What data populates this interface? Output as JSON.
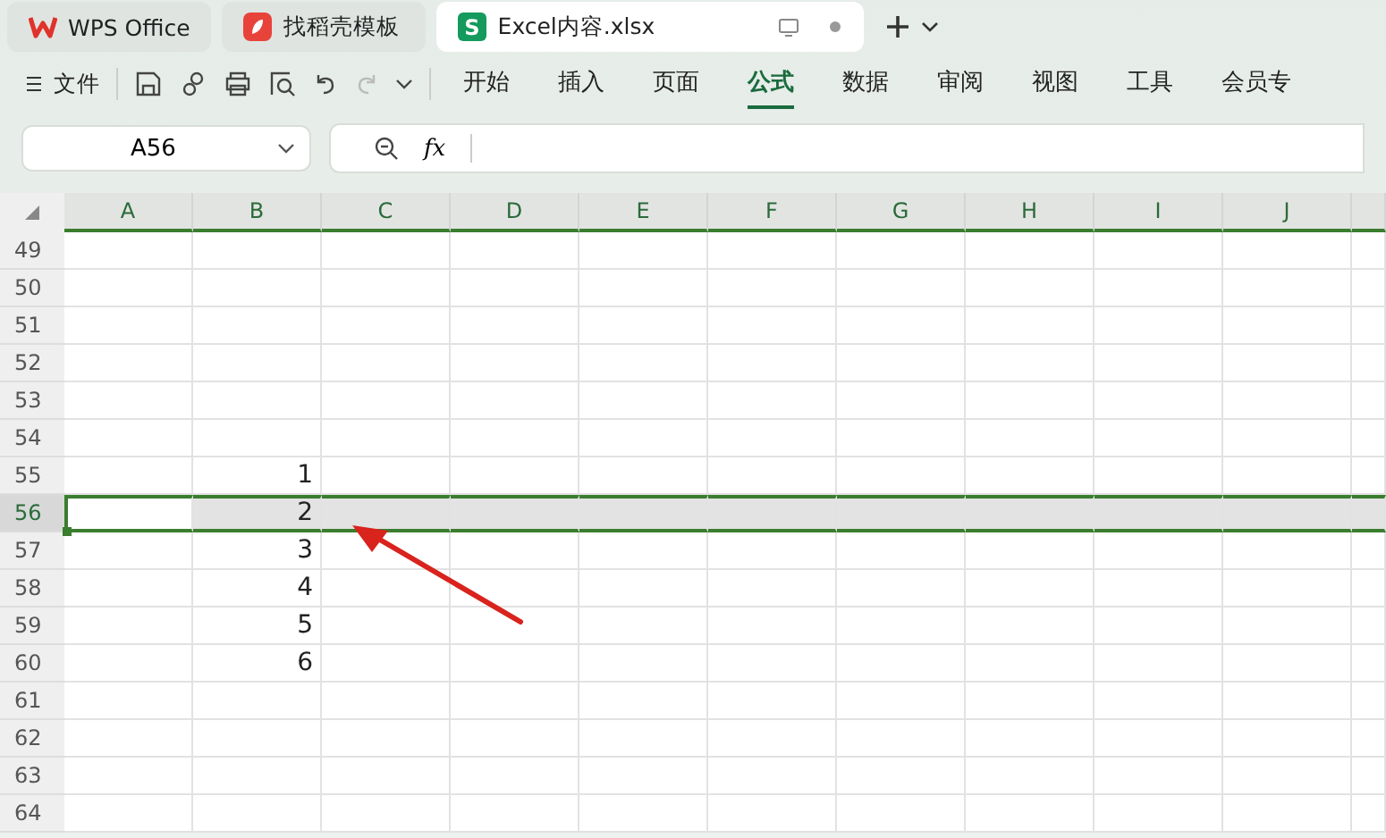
{
  "tabs": [
    {
      "label": "WPS Office",
      "kind": "home",
      "selected": false
    },
    {
      "label": "找稻壳模板",
      "kind": "template",
      "selected": false
    },
    {
      "label": "Excel内容.xlsx",
      "kind": "sheet",
      "selected": true,
      "icon_text": "S"
    }
  ],
  "menu": {
    "label": "文件"
  },
  "ribbon_tabs": [
    {
      "label": "开始",
      "selected": false
    },
    {
      "label": "插入",
      "selected": false
    },
    {
      "label": "页面",
      "selected": false
    },
    {
      "label": "公式",
      "selected": true
    },
    {
      "label": "数据",
      "selected": false
    },
    {
      "label": "审阅",
      "selected": false
    },
    {
      "label": "视图",
      "selected": false
    },
    {
      "label": "工具",
      "selected": false
    },
    {
      "label": "会员专",
      "selected": false
    }
  ],
  "name_box": {
    "value": "A56"
  },
  "formula_bar": {
    "fx": "fx"
  },
  "columns": [
    "A",
    "B",
    "C",
    "D",
    "E",
    "F",
    "G",
    "H",
    "I",
    "J"
  ],
  "rows": [
    {
      "number": "49",
      "selected": false
    },
    {
      "number": "50",
      "selected": false
    },
    {
      "number": "51",
      "selected": false
    },
    {
      "number": "52",
      "selected": false
    },
    {
      "number": "53",
      "selected": false
    },
    {
      "number": "54",
      "selected": false
    },
    {
      "number": "55",
      "selected": false,
      "column_b": "1"
    },
    {
      "number": "56",
      "selected": true,
      "column_b": "2"
    },
    {
      "number": "57",
      "selected": false,
      "column_b": "3"
    },
    {
      "number": "58",
      "selected": false,
      "column_b": "4"
    },
    {
      "number": "59",
      "selected": false,
      "column_b": "5"
    },
    {
      "number": "60",
      "selected": false,
      "column_b": "6"
    },
    {
      "number": "61",
      "selected": false
    },
    {
      "number": "62",
      "selected": false
    },
    {
      "number": "63",
      "selected": false
    },
    {
      "number": "64",
      "selected": false
    }
  ]
}
